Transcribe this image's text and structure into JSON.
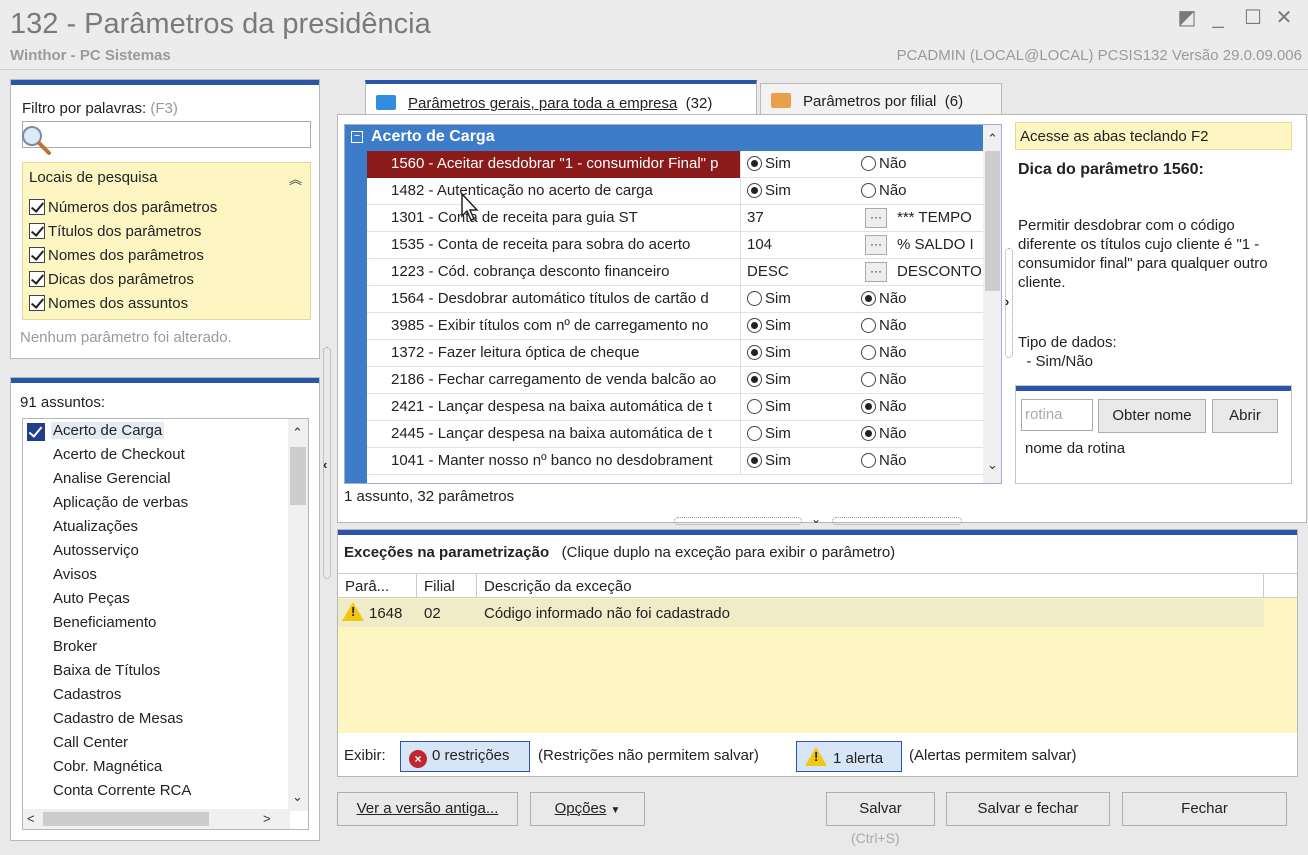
{
  "window": {
    "title": "132 - Parâmetros da presidência",
    "subtitle": "Winthor - PC Sistemas",
    "status": "PCADMIN (LOCAL@LOCAL)   PCSIS132  Versão  29.0.09.006"
  },
  "filter": {
    "label": "Filtro por palavras:",
    "hotkey": "(F3)",
    "value": "",
    "locations_title": "Locais de pesquisa",
    "options": [
      {
        "label": "Números dos parâmetros",
        "checked": true
      },
      {
        "label": "Títulos dos parâmetros",
        "checked": true
      },
      {
        "label": "Nomes dos parâmetros",
        "checked": true
      },
      {
        "label": "Dicas dos parâmetros",
        "checked": true
      },
      {
        "label": "Nomes dos assuntos",
        "checked": true
      }
    ],
    "no_change": "Nenhum parâmetro foi alterado."
  },
  "subjects": {
    "count": "91 assuntos:",
    "items": [
      "Acerto de Carga",
      "Acerto de Checkout",
      "Analise Gerencial",
      "Aplicação de verbas",
      "Atualizações",
      "Autosserviço",
      "Avisos",
      "Auto Peças",
      "Beneficiamento",
      "Broker",
      "Baixa de Títulos",
      "Cadastros",
      "Cadastro de Mesas",
      "Call Center",
      "Cobr. Magnética",
      "Conta Corrente RCA"
    ]
  },
  "tabs": [
    {
      "label": "Parâmetros gerais, para toda a empresa",
      "count": "(32)"
    },
    {
      "label": "Parâmetros por filial",
      "count": "(6)"
    }
  ],
  "grid": {
    "group": "Acerto de Carga",
    "yes": "Sim",
    "no": "Não",
    "rows": [
      {
        "name": "1560 - Aceitar desdobrar \"1 - consumidor Final\" p",
        "type": "bool",
        "value": "yes"
      },
      {
        "name": "1482 - Autenticação no acerto de carga",
        "type": "bool",
        "value": "yes"
      },
      {
        "name": "1301 - Conta de receita para guia ST",
        "type": "lookup",
        "value": "37",
        "desc": "*** TEMPO"
      },
      {
        "name": "1535 - Conta de receita para sobra do acerto",
        "type": "lookup",
        "value": "104",
        "desc": "% SALDO I"
      },
      {
        "name": "1223 - Cód. cobrança desconto financeiro",
        "type": "lookup",
        "value": "DESC",
        "desc": "DESCONTO"
      },
      {
        "name": "1564 - Desdobrar automático títulos de cartão d",
        "type": "bool",
        "value": "no"
      },
      {
        "name": "3985 - Exibir títulos com nº de carregamento no",
        "type": "bool",
        "value": "yes"
      },
      {
        "name": "1372 - Fazer leitura óptica de cheque",
        "type": "bool",
        "value": "yes"
      },
      {
        "name": "2186 - Fechar carregamento de venda balcão ao",
        "type": "bool",
        "value": "yes"
      },
      {
        "name": "2421 - Lançar despesa na baixa automática de t",
        "type": "bool",
        "value": "no"
      },
      {
        "name": "2445 - Lançar despesa na baixa automática de t",
        "type": "bool",
        "value": "no"
      },
      {
        "name": "1041 - Manter nosso nº banco no desdobrament",
        "type": "bool",
        "value": "yes"
      }
    ],
    "summary": "1 assunto, 32 parâmetros"
  },
  "tip": {
    "hint": "Acesse as abas teclando F2",
    "title": "Dica do parâmetro 1560:",
    "text": "Permitir desdobrar com o código diferente os títulos cujo cliente é \"1 - consumidor final\" para qualquer outro cliente.",
    "types_label": "Tipo de dados:",
    "types_value": "  - Sim/Não",
    "routine_placeholder": "rotina",
    "get_name": "Obter nome",
    "open": "Abrir",
    "routine_name": "nome da rotina"
  },
  "exceptions": {
    "title": "Exceções na parametrização",
    "hint": "(Clique duplo na exceção para exibir o parâmetro)",
    "columns": [
      "Parâ...",
      "Filial",
      "Descrição da exceção"
    ],
    "rows": [
      {
        "param": "1648",
        "branch": "02",
        "desc": "Código informado não foi cadastrado"
      }
    ],
    "show_label": "Exibir:",
    "restrictions": "0 restrições",
    "restrictions_note": "(Restrições não permitem salvar)",
    "alerts": "1 alerta",
    "alerts_note": "(Alertas permitem salvar)"
  },
  "buttons": {
    "old_version": "Ver a versão antiga...",
    "options": "Opções",
    "save": "Salvar",
    "save_shortcut": "(Ctrl+S)",
    "save_close": "Salvar e fechar",
    "close": "Fechar"
  },
  "colors": {
    "accent": "#2b56a8",
    "group": "#3d7cc9",
    "selected": "#8b1a1a",
    "note": "#fdf6c3"
  }
}
